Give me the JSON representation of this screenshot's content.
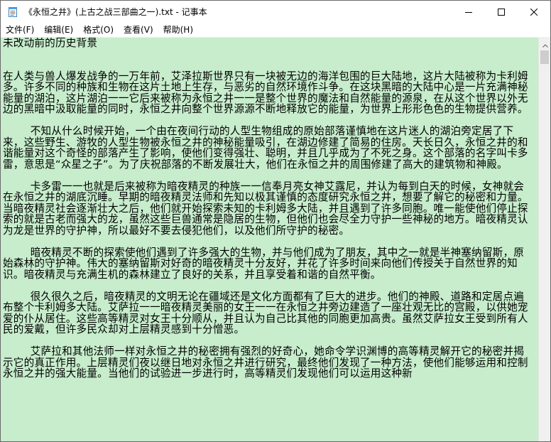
{
  "window": {
    "title": "《永恒之井》(上古之战三部曲之一).txt - 记事本"
  },
  "icons": {
    "app": "notepad-icon",
    "minimize": "minimize-icon",
    "maximize": "maximize-icon",
    "close": "close-icon",
    "scroll_up": "chevron-up-icon"
  },
  "menu": {
    "items": [
      {
        "label": "文件(F)"
      },
      {
        "label": "编辑(E)"
      },
      {
        "label": "格式(O)"
      },
      {
        "label": "查看(V)"
      },
      {
        "label": "帮助(H)"
      }
    ]
  },
  "document": {
    "content": "未改动前的历史背景\n\n\n在人类与兽人爆发战争的一万年前，艾泽拉斯世界只有一块被无边的海洋包围的巨大陆地，这片大陆被称为卡利姆多。许多不同的种族和生物在这片土地上生存，与恶劣的自然环境作斗争。在这块黑暗的大陆中心是一片充满神秘能量的湖泊，这片湖泊一一它后来被称为永恒之井一一是整个世界的魔法和自然能量的源泉，在从这个世界以外无边的黑暗中汲取能量的同时，永恒之井向整个世界源源不断地释放它的能量，为世界上形形色色的生物提供营养。\n\n\t不知从什么时候开始，一个由在夜间行动的人型生物组成的原始部落谨慎地在这片迷人的湖泊旁定居了下来，这些野生、游牧的人型生物被永恒之井的神秘能量吸引，在湖边修建了简易的住房。天长日久，永恒之井的和谐能量对这个奇怪的部落产生了影响，使他们变得强壮、聪明，并且几乎成为了不死之身。这个部落的名字叫卡多雷，意思是“众星之子”。为了庆祝部落的不断发展壮大，他们在永恒之井的周围修建了高大的建筑物和神殿。\n\n\t卡多雷一一也就是后来被称为暗夜精灵的种族一一信奉月亮女神艾露尼，并认为每到白天的时候，女神就会在永恒之井的湖底沉睡。早期的暗夜精灵法师和先知以极其谨慎的态度研究永恒之井，想要了解它的秘密和力量。当暗夜精灵社会逐渐壮大之后，他们就开始探索未知的卡利姆多大陆，并且遇到了许多同胞。唯一能使他们停止探索的就是古老而强大的龙，虽然这些巨兽通常是隐居的生物，但他们也会尽全力守护一些神秘的地方。暗夜精灵认为龙是世界的守护神，所以最好不要去侵犯他们，以及他们所守护的秘密。\n\n\t暗夜精灵不断的探索使他们遇到了许多强大的生物，并与他们成为了朋友，其中之一就是半神塞纳留斯，原始森林的守护神。伟大的塞纳留斯对好奇的暗夜精灵十分友好，并花了许多时间来向他们传授关于自然世界的知识。暗夜精灵与充满生机的森林建立了良好的关系，并且享受着和谐的自然平衡。\n\n\t很久很久之后，暗夜精灵的文明无论在疆域还是文化方面都有了巨大的进步。他们的神殿、道路和定居点遍布整个卡利姆多大陆。艾萨拉一一暗夜精灵美丽的女王一一在永恒之井旁边建造了一座壮观无比的宫殿，以供她宠爱的仆从居住。这些高等精灵对女王十分顺从，并且认为自己比其他的同胞更加高贵。虽然艾萨拉女王受到所有人民的爱戴，但许多民众却对上层精灵感到十分憎恶。\n\n\t艾萨拉和其他法师一样对永恒之井的秘密拥有强烈的好奇心，她命令学识渊博的高等精灵解开它的秘密并揭示它的真正作用。上层精灵们夜以继日地对永恒之井进行研究，最终他们发现了一种方法，使他们能够运用和控制永恒之井的强大能量。当他们的试验进一步进行时，高等精灵们发现他们可以运用这种新"
  }
}
